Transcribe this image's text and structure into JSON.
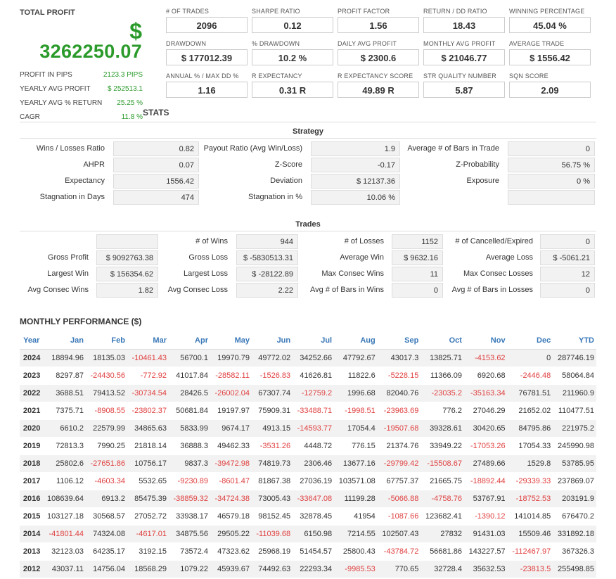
{
  "profit": {
    "title": "TOTAL PROFIT",
    "currency": "$",
    "value": "3262250.07",
    "rows": [
      {
        "label": "PROFIT IN PIPS",
        "value": "2123.3 PIPS"
      },
      {
        "label": "YEARLY AVG PROFIT",
        "value": "$ 252513.1"
      },
      {
        "label": "YEARLY AVG % RETURN",
        "value": "25.25 %"
      },
      {
        "label": "CAGR",
        "value": "11.8 %"
      }
    ]
  },
  "metrics": [
    {
      "label": "# OF TRADES",
      "value": "2096"
    },
    {
      "label": "SHARPE RATIO",
      "value": "0.12"
    },
    {
      "label": "PROFIT FACTOR",
      "value": "1.56"
    },
    {
      "label": "RETURN / DD RATIO",
      "value": "18.43"
    },
    {
      "label": "WINNING PERCENTAGE",
      "value": "45.04 %"
    },
    {
      "label": "DRAWDOWN",
      "value": "$ 177012.39"
    },
    {
      "label": "% DRAWDOWN",
      "value": "10.2 %"
    },
    {
      "label": "DAILY AVG PROFIT",
      "value": "$ 2300.6"
    },
    {
      "label": "MONTHLY AVG PROFIT",
      "value": "$ 21046.77"
    },
    {
      "label": "AVERAGE TRADE",
      "value": "$ 1556.42"
    },
    {
      "label": "ANNUAL % / MAX DD %",
      "value": "1.16"
    },
    {
      "label": "R EXPECTANCY",
      "value": "0.31 R"
    },
    {
      "label": "R EXPECTANCY SCORE",
      "value": "49.89 R"
    },
    {
      "label": "STR QUALITY NUMBER",
      "value": "5.87"
    },
    {
      "label": "SQN SCORE",
      "value": "2.09"
    }
  ],
  "stats_title": "STATS",
  "strategy": {
    "title": "Strategy",
    "rows": [
      [
        {
          "label": "Wins / Losses Ratio",
          "value": "0.82"
        },
        {
          "label": "Payout Ratio (Avg Win/Loss)",
          "value": "1.9"
        },
        {
          "label": "Average # of Bars in Trade",
          "value": "0"
        }
      ],
      [
        {
          "label": "AHPR",
          "value": "0.07"
        },
        {
          "label": "Z-Score",
          "value": "-0.17"
        },
        {
          "label": "Z-Probability",
          "value": "56.75 %"
        }
      ],
      [
        {
          "label": "Expectancy",
          "value": "1556.42"
        },
        {
          "label": "Deviation",
          "value": "$ 12137.36"
        },
        {
          "label": "Exposure",
          "value": "0 %"
        }
      ],
      [
        {
          "label": "Stagnation in Days",
          "value": "474"
        },
        {
          "label": "Stagnation in %",
          "value": "10.06 %"
        },
        {
          "label": "",
          "value": ""
        }
      ]
    ]
  },
  "trades": {
    "title": "Trades",
    "rows": [
      [
        {
          "label": "",
          "value": ""
        },
        {
          "label": "# of Wins",
          "value": "944"
        },
        {
          "label": "# of Losses",
          "value": "1152"
        },
        {
          "label": "# of Cancelled/Expired",
          "value": "0"
        }
      ],
      [
        {
          "label": "Gross Profit",
          "value": "$ 9092763.38"
        },
        {
          "label": "Gross Loss",
          "value": "$ -5830513.31"
        },
        {
          "label": "Average Win",
          "value": "$ 9632.16"
        },
        {
          "label": "Average Loss",
          "value": "$ -5061.21"
        }
      ],
      [
        {
          "label": "Largest Win",
          "value": "$ 156354.62"
        },
        {
          "label": "Largest Loss",
          "value": "$ -28122.89"
        },
        {
          "label": "Max Consec Wins",
          "value": "11"
        },
        {
          "label": "Max Consec Losses",
          "value": "12"
        }
      ],
      [
        {
          "label": "Avg Consec Wins",
          "value": "1.82"
        },
        {
          "label": "Avg Consec Loss",
          "value": "2.22"
        },
        {
          "label": "Avg # of Bars in Wins",
          "value": "0"
        },
        {
          "label": "Avg # of Bars in Losses",
          "value": "0"
        }
      ]
    ]
  },
  "monthly": {
    "title": "MONTHLY PERFORMANCE ($)",
    "headers": [
      "Year",
      "Jan",
      "Feb",
      "Mar",
      "Apr",
      "May",
      "Jun",
      "Jul",
      "Aug",
      "Sep",
      "Oct",
      "Nov",
      "Dec",
      "YTD"
    ],
    "rows": [
      [
        "2024",
        "18894.96",
        "18135.03",
        "-10461.43",
        "56700.1",
        "19970.79",
        "49772.02",
        "34252.66",
        "47792.67",
        "43017.3",
        "13825.71",
        "-4153.62",
        "0",
        "287746.19"
      ],
      [
        "2023",
        "8297.87",
        "-24430.56",
        "-772.92",
        "41017.84",
        "-28582.11",
        "-1526.83",
        "41626.81",
        "11822.6",
        "-5228.15",
        "11366.09",
        "6920.68",
        "-2446.48",
        "58064.84"
      ],
      [
        "2022",
        "3688.51",
        "79413.52",
        "-30734.54",
        "28426.5",
        "-26002.04",
        "67307.74",
        "-12759.2",
        "1996.68",
        "82040.76",
        "-23035.2",
        "-35163.34",
        "76781.51",
        "211960.9"
      ],
      [
        "2021",
        "7375.71",
        "-8908.55",
        "-23802.37",
        "50681.84",
        "19197.97",
        "75909.31",
        "-33488.71",
        "-1998.51",
        "-23963.69",
        "776.2",
        "27046.29",
        "21652.02",
        "110477.51"
      ],
      [
        "2020",
        "6610.2",
        "22579.99",
        "34865.63",
        "5833.99",
        "9674.17",
        "4913.15",
        "-14593.77",
        "17054.4",
        "-19507.68",
        "39328.61",
        "30420.65",
        "84795.86",
        "221975.2"
      ],
      [
        "2019",
        "72813.3",
        "7990.25",
        "21818.14",
        "36888.3",
        "49462.33",
        "-3531.26",
        "4448.72",
        "776.15",
        "21374.76",
        "33949.22",
        "-17053.26",
        "17054.33",
        "245990.98"
      ],
      [
        "2018",
        "25802.6",
        "-27651.86",
        "10756.17",
        "9837.3",
        "-39472.98",
        "74819.73",
        "2306.46",
        "13677.16",
        "-29799.42",
        "-15508.67",
        "27489.66",
        "1529.8",
        "53785.95"
      ],
      [
        "2017",
        "1106.12",
        "-4603.34",
        "5532.65",
        "-9230.89",
        "-8601.47",
        "81867.38",
        "27036.19",
        "103571.08",
        "67757.37",
        "21665.75",
        "-18892.44",
        "-29339.33",
        "237869.07"
      ],
      [
        "2016",
        "108639.64",
        "6913.2",
        "85475.39",
        "-38859.32",
        "-34724.38",
        "73005.43",
        "-33647.08",
        "11199.28",
        "-5066.88",
        "-4758.76",
        "53767.91",
        "-18752.53",
        "203191.9"
      ],
      [
        "2015",
        "103127.18",
        "30568.57",
        "27052.72",
        "33938.17",
        "46579.18",
        "98152.45",
        "32878.45",
        "41954",
        "-1087.66",
        "123682.41",
        "-1390.12",
        "141014.85",
        "676470.2"
      ],
      [
        "2014",
        "-41801.44",
        "74324.08",
        "-4617.01",
        "34875.56",
        "29505.22",
        "-11039.68",
        "6150.98",
        "7214.55",
        "102507.43",
        "27832",
        "91431.03",
        "15509.46",
        "331892.18"
      ],
      [
        "2013",
        "32123.03",
        "64235.17",
        "3192.15",
        "73572.4",
        "47323.62",
        "25968.19",
        "51454.57",
        "25800.43",
        "-43784.72",
        "56681.86",
        "143227.57",
        "-112467.97",
        "367326.3"
      ],
      [
        "2012",
        "43037.11",
        "14756.04",
        "18568.29",
        "1079.22",
        "45939.67",
        "74492.63",
        "22293.34",
        "-9985.53",
        "770.65",
        "32728.4",
        "35632.53",
        "-23813.5",
        "255498.85"
      ]
    ]
  }
}
